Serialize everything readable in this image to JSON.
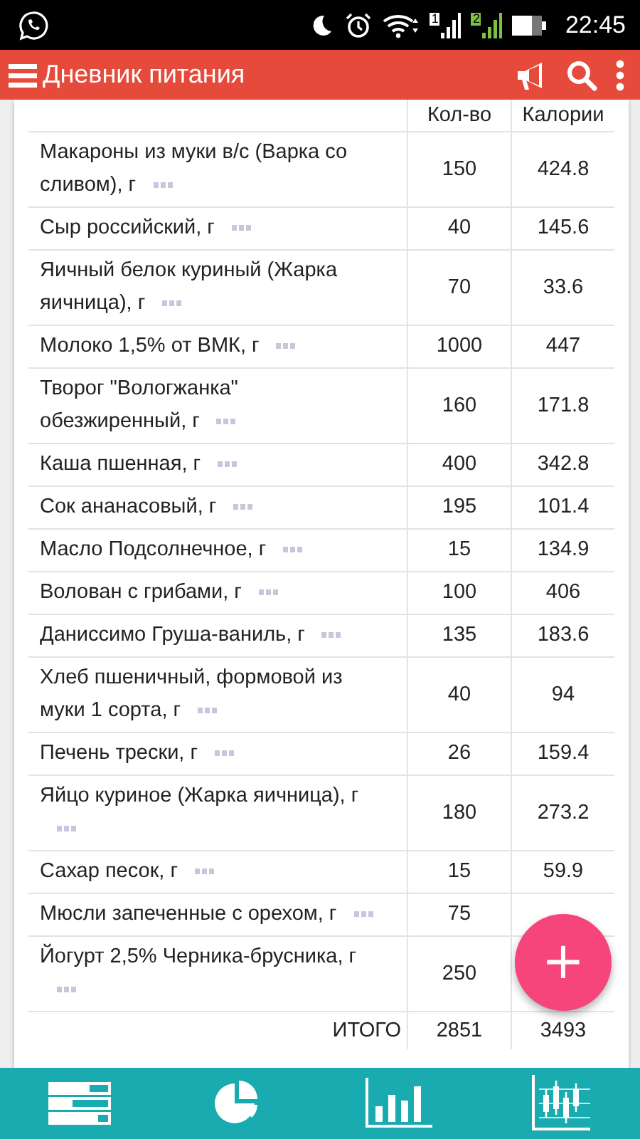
{
  "status_bar": {
    "time": "22:45",
    "sim_1": "1",
    "sim_2": "2"
  },
  "app_bar": {
    "title": "Дневник питания"
  },
  "table": {
    "columns": [
      "Кол-во",
      "Калории"
    ],
    "rows": [
      {
        "name": "Макароны из муки в/с (Варка со сливом), г",
        "qty": "150",
        "cal": "424.8"
      },
      {
        "name": "Сыр российский, г",
        "qty": "40",
        "cal": "145.6"
      },
      {
        "name": "Яичный белок куриный (Жарка яичница), г",
        "qty": "70",
        "cal": "33.6"
      },
      {
        "name": "Молоко 1,5% от ВМК, г",
        "qty": "1000",
        "cal": "447"
      },
      {
        "name": "Творог \"Вологжанка\" обезжиренный, г",
        "qty": "160",
        "cal": "171.8"
      },
      {
        "name": "Каша пшенная, г",
        "qty": "400",
        "cal": "342.8"
      },
      {
        "name": "Сок ананасовый, г",
        "qty": "195",
        "cal": "101.4"
      },
      {
        "name": "Масло Подсолнечное, г",
        "qty": "15",
        "cal": "134.9"
      },
      {
        "name": "Волован с грибами, г",
        "qty": "100",
        "cal": "406"
      },
      {
        "name": "Даниссимо Груша-ваниль, г",
        "qty": "135",
        "cal": "183.6"
      },
      {
        "name": "Хлеб пшеничный, формовой из муки 1 сорта, г",
        "qty": "40",
        "cal": "94"
      },
      {
        "name": "Печень трески, г",
        "qty": "26",
        "cal": "159.4"
      },
      {
        "name": "Яйцо куриное (Жарка яичница), г",
        "qty": "180",
        "cal": "273.2"
      },
      {
        "name": "Сахар песок, г",
        "qty": "15",
        "cal": "59.9"
      },
      {
        "name": "Мюсли запеченные с орехом, г",
        "qty": "75"
      },
      {
        "name": "Йогурт 2,5% Черника-брусника, г",
        "qty": "250"
      }
    ],
    "total": {
      "label": "ИТОГО",
      "qty": "2851",
      "cal": "3493"
    }
  },
  "fab": {
    "label": "+"
  }
}
